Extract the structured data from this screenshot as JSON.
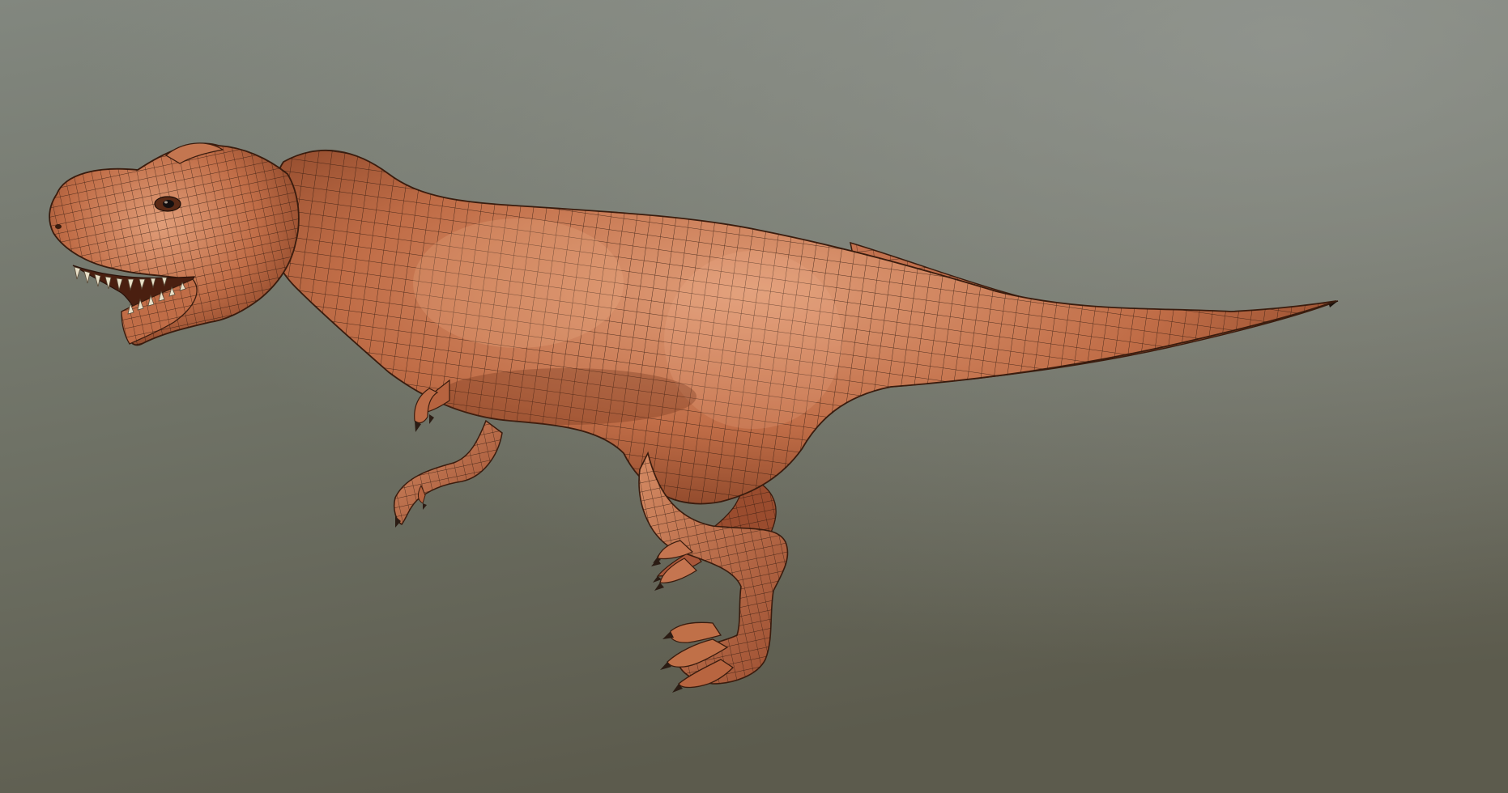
{
  "scene": {
    "subject": "t-rex-wireframe-model",
    "background_colors": {
      "top_right": "#8a8e89",
      "top_left": "#7c8178",
      "bottom_left": "#5e5e4f",
      "bottom_right": "#6d6c62"
    },
    "model_colors": {
      "skin_light": "#d9906a",
      "skin_mid": "#b7623f",
      "skin_dark": "#7a3b22",
      "wire": "#2a150c",
      "teeth": "#e8e0c8",
      "claw": "#3a2a20"
    }
  }
}
